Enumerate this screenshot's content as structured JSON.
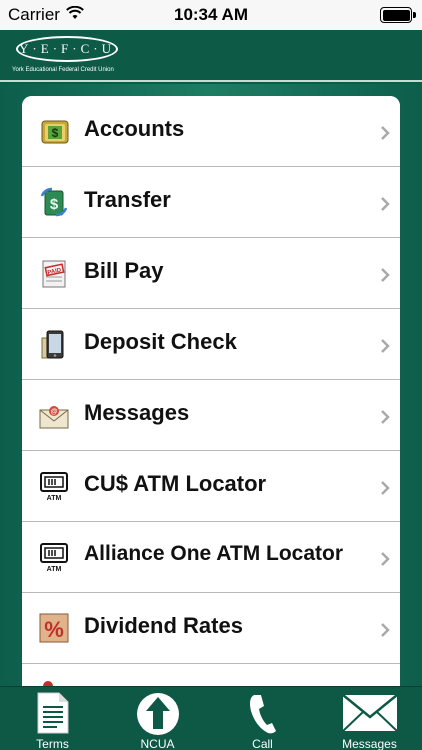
{
  "status_bar": {
    "carrier": "Carrier",
    "time": "10:34 AM"
  },
  "header": {
    "logo_text": "Y·E·F·C·U",
    "tagline": "York Educational Federal Credit Union"
  },
  "menu": {
    "items": [
      {
        "label": "Accounts",
        "icon": "money-bag-icon"
      },
      {
        "label": "Transfer",
        "icon": "transfer-icon"
      },
      {
        "label": "Bill Pay",
        "icon": "paid-bill-icon"
      },
      {
        "label": "Deposit Check",
        "icon": "mobile-deposit-icon"
      },
      {
        "label": "Messages",
        "icon": "envelope-icon"
      },
      {
        "label": "CU$ ATM Locator",
        "icon": "atm-icon"
      },
      {
        "label": "Alliance One ATM Locator",
        "icon": "atm-icon"
      },
      {
        "label": "Dividend Rates",
        "icon": "percent-icon"
      }
    ]
  },
  "tabbar": {
    "tabs": [
      {
        "label": "Terms",
        "icon": "document-icon"
      },
      {
        "label": "NCUA",
        "icon": "ncua-logo-icon"
      },
      {
        "label": "Call",
        "icon": "phone-icon"
      },
      {
        "label": "Messages",
        "icon": "envelope-icon"
      }
    ]
  },
  "colors": {
    "brand_green": "#0d5b47",
    "menu_background": "#ffffff",
    "chevron": "#a9a9a9"
  }
}
